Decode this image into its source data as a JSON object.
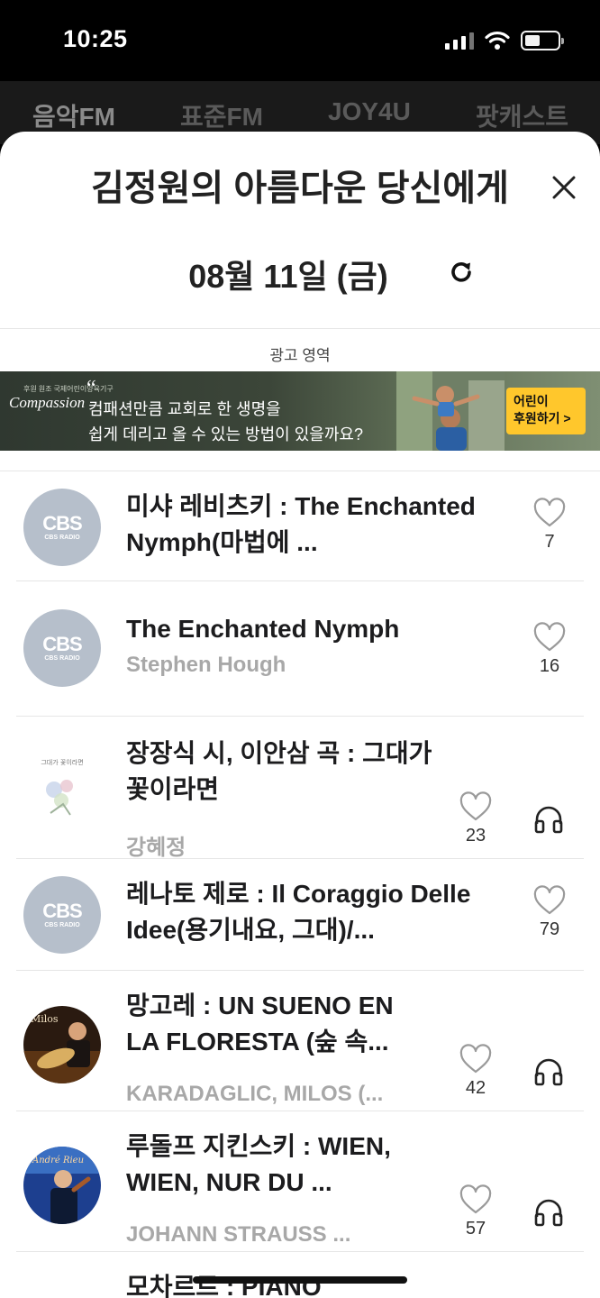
{
  "status_bar": {
    "time": "10:25",
    "icons": [
      "signal-icon",
      "wifi-icon",
      "battery-icon"
    ]
  },
  "bg_tabs": [
    "음악FM",
    "표준FM",
    "JOY4U",
    "팟캐스트"
  ],
  "sheet": {
    "title": "김정원의 아름다운 당신에게",
    "date": "08월 11일 (금)",
    "ad_label": "광고 영역"
  },
  "ad": {
    "logo_small": "후원 원조 국제어린이양육기구",
    "logo_brand": "Compassion",
    "quote_mark": "“",
    "line1": "컴패션만큼 교회로 한 생명을",
    "line2": "쉽게 데리고 올 수 있는 방법이 있을까요?",
    "cta_line1": "어린이",
    "cta_line2": "후원하기 >"
  },
  "cbs": {
    "logo": "CBS",
    "sub": "CBS RADIO"
  },
  "songs": [
    {
      "title": "미샤 레비츠키 : The Enchanted Nymph(마법에 ...",
      "artist": "",
      "likes": "7",
      "thumb": "cbs",
      "listen": false
    },
    {
      "title": "The Enchanted Nymph",
      "artist": "Stephen Hough",
      "likes": "16",
      "thumb": "cbs",
      "listen": false
    },
    {
      "title": "장장식 시, 이안삼 곡 : 그대가 꽃이라면",
      "artist": "강혜정",
      "likes": "23",
      "thumb": "album",
      "listen": true
    },
    {
      "title": "레나토 제로 : Il Coraggio Delle Idee(용기내요, 그대)/...",
      "artist": "",
      "likes": "79",
      "thumb": "cbs",
      "listen": false
    },
    {
      "title": "망고레 : UN SUENO EN LA FLORESTA (숲 속...",
      "artist": "KARADAGLIC, MILOS (...",
      "likes": "42",
      "thumb": "album",
      "listen": true
    },
    {
      "title": "루돌프 지킨스키 : WIEN, WIEN, NUR DU ...",
      "artist": "JOHANN STRAUSS ...",
      "likes": "57",
      "thumb": "album",
      "listen": true
    },
    {
      "title": "모차르트 : PIANO",
      "artist": "",
      "likes": "",
      "thumb": "cbs",
      "listen": false
    }
  ]
}
